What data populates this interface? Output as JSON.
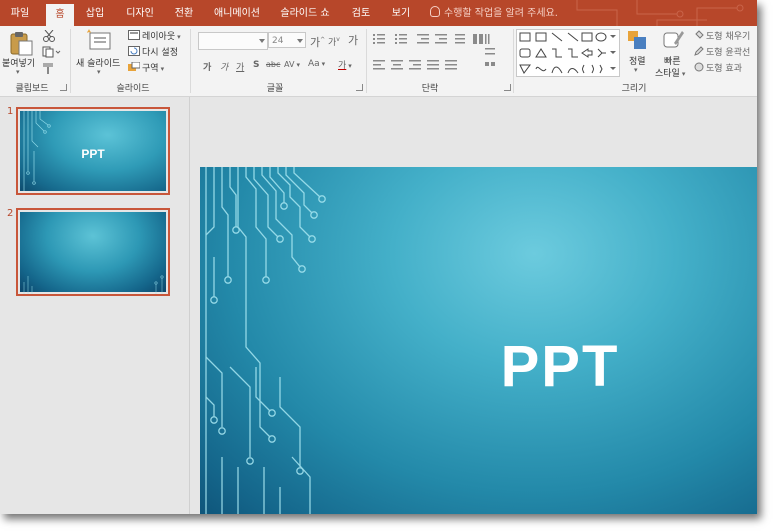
{
  "tabs": [
    {
      "label": "파일",
      "active": false
    },
    {
      "label": "홈",
      "active": true
    },
    {
      "label": "삽입",
      "active": false
    },
    {
      "label": "디자인",
      "active": false
    },
    {
      "label": "전환",
      "active": false
    },
    {
      "label": "애니메이션",
      "active": false
    },
    {
      "label": "슬라이드 쇼",
      "active": false
    },
    {
      "label": "검토",
      "active": false
    },
    {
      "label": "보기",
      "active": false
    }
  ],
  "tell_me": "수행할 작업을 알려 주세요.",
  "ribbon": {
    "clipboard": {
      "paste": "붙여넣기",
      "label": "클립보드"
    },
    "slides": {
      "new_slide": "새 슬라이드",
      "layout": "레이아웃",
      "reset": "다시 설정",
      "section": "구역",
      "label": "슬라이드"
    },
    "font": {
      "size": "24",
      "label": "글꼴",
      "grow": "가",
      "shrink": "가",
      "clear": "가",
      "bold": "가",
      "italic": "가",
      "underline": "가",
      "shadow": "S",
      "strike": "abc",
      "spacing": "AV",
      "case": "Aa",
      "color": "가"
    },
    "paragraph": {
      "label": "단락"
    },
    "drawing": {
      "arrange": "정렬",
      "quick_styles_1": "빠른",
      "quick_styles_2": "스타일",
      "fill": "도형 채우기",
      "outline": "도형 윤곽선",
      "effects": "도형 효과",
      "label": "그리기"
    }
  },
  "slides": [
    {
      "number": "1",
      "title": "PPT"
    },
    {
      "number": "2",
      "title": ""
    }
  ],
  "current_slide": {
    "title": "PPT"
  },
  "colors": {
    "accent": "#b7472a",
    "slide_bg": "#2f9bb7"
  }
}
